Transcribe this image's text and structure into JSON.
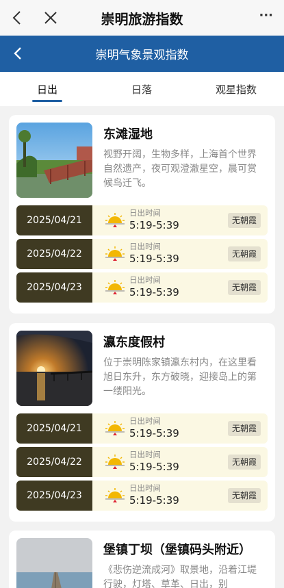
{
  "app": {
    "title": "崇明旅游指数",
    "more": "···"
  },
  "subheader": {
    "title": "崇明气象景观指数"
  },
  "tabs": [
    {
      "label": "日出",
      "active": true
    },
    {
      "label": "日落",
      "active": false
    },
    {
      "label": "观星指数",
      "active": false
    }
  ],
  "colors": {
    "header_blue": "#1f5fa3",
    "date_bg": "#3f3a22",
    "row_bg": "#fbf8e3",
    "sun": "#f2b705"
  },
  "spots": [
    {
      "name": "东滩湿地",
      "desc": "视野开阔，生物多样，上海首个世界自然遗产，夜可观澄澈星空，晨可赏候鸟迁飞。",
      "image_icon": "wetland-boardwalk-photo",
      "rows": [
        {
          "date": "2025/04/21",
          "label": "日出时间",
          "time": "5:19-5:39",
          "badge": "无朝霞"
        },
        {
          "date": "2025/04/22",
          "label": "日出时间",
          "time": "5:19-5:39",
          "badge": "无朝霞"
        },
        {
          "date": "2025/04/23",
          "label": "日出时间",
          "time": "5:19-5:39",
          "badge": "无朝霞"
        }
      ]
    },
    {
      "name": "瀛东度假村",
      "desc": "位于崇明陈家镇瀛东村内，在这里看旭日东升，东方破晓，迎接岛上的第一缕阳光。",
      "image_icon": "sunrise-over-water-photo",
      "rows": [
        {
          "date": "2025/04/21",
          "label": "日出时间",
          "time": "5:19-5:39",
          "badge": "无朝霞"
        },
        {
          "date": "2025/04/22",
          "label": "日出时间",
          "time": "5:19-5:39",
          "badge": "无朝霞"
        },
        {
          "date": "2025/04/23",
          "label": "日出时间",
          "time": "5:19-5:39",
          "badge": "无朝霞"
        }
      ]
    },
    {
      "name": "堡镇丁坝（堡镇码头附近）",
      "desc": "《悲伤逆流成河》取景地，沿着江堤行驶，灯塔、草革、日出，别",
      "image_icon": "pier-seaside-photo",
      "rows": []
    }
  ]
}
